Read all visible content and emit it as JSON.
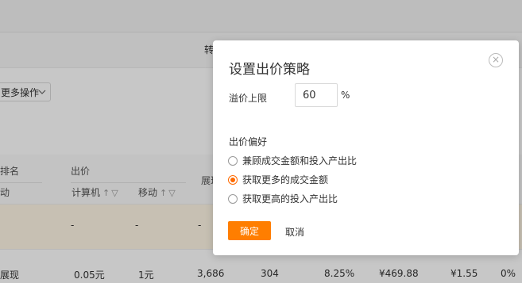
{
  "background": {
    "tab_label": "转",
    "more_actions": "更多操作",
    "table": {
      "headers": {
        "rank": "排名",
        "rank_sub": "动",
        "bid": "出价",
        "bid_computer": "计算机",
        "bid_mobile": "移动",
        "impressions": "展现"
      },
      "empty_row": [
        "-",
        "-",
        "-"
      ],
      "row": {
        "name": "展现",
        "values": [
          "0.05元",
          "1元",
          "3,686",
          "304",
          "8.25%",
          "¥469.88",
          "¥1.55",
          "0%"
        ]
      }
    }
  },
  "modal": {
    "title": "设置出价策略",
    "premium_limit_label": "溢价上限",
    "premium_limit_value": "60",
    "unit": "%",
    "preference_label": "出价偏好",
    "options": [
      {
        "label": "兼顾成交金额和投入产出比",
        "checked": false
      },
      {
        "label": "获取更多的成交金额",
        "checked": true
      },
      {
        "label": "获取更高的投入产出比",
        "checked": false
      }
    ],
    "ok_label": "确定",
    "cancel_label": "取消"
  },
  "colors": {
    "accent": "#ff7e00",
    "radio_checked": "#ff6a00",
    "highlight_row": "#fff7e6"
  }
}
